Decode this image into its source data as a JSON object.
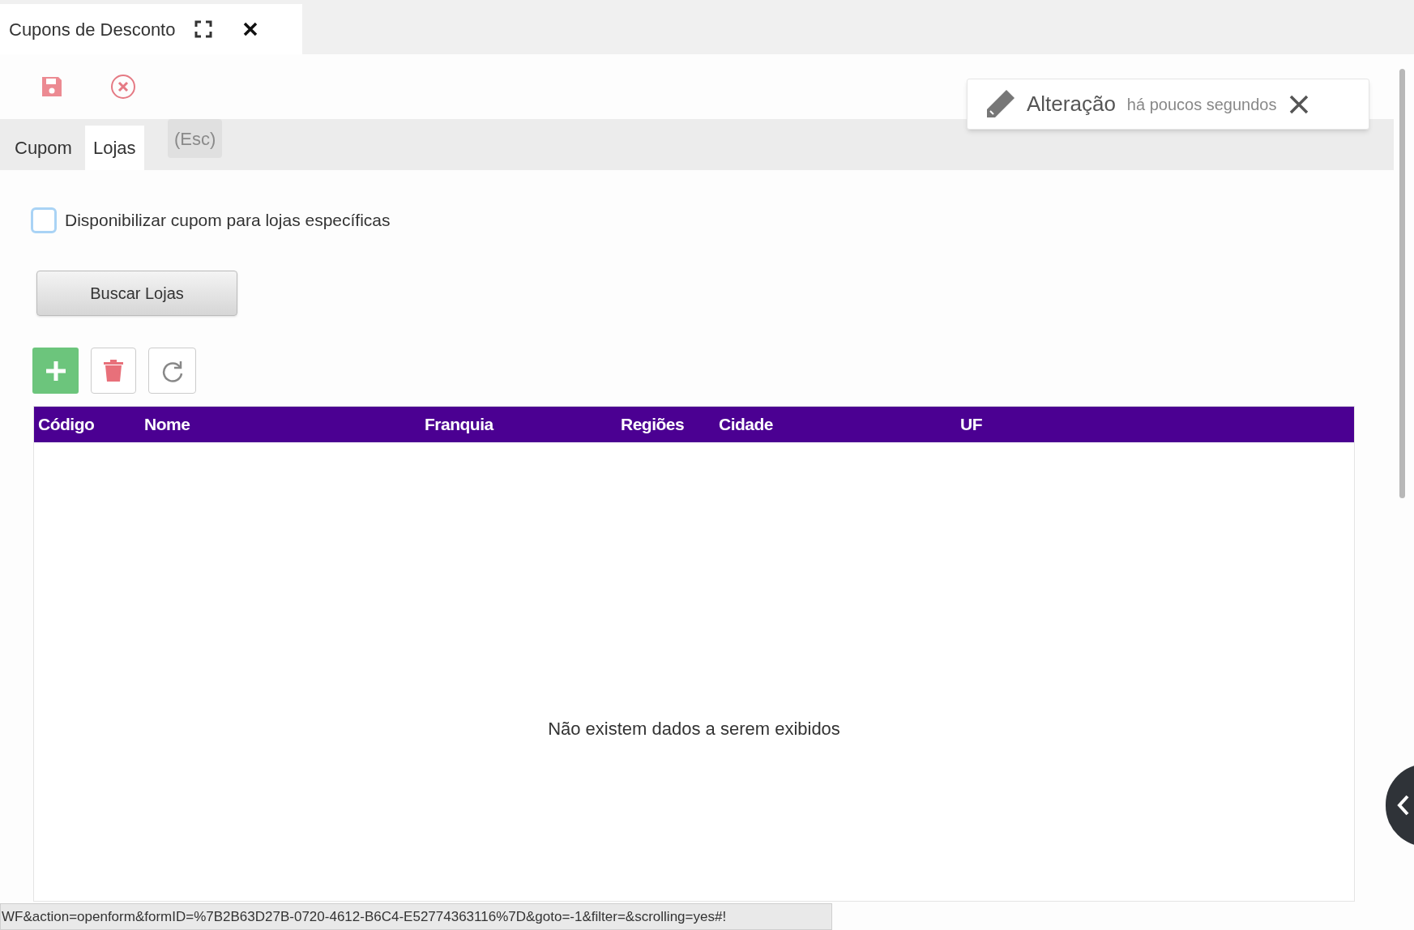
{
  "window_tab": {
    "title": "Cupons de Desconto"
  },
  "toolbar": {
    "tooltip": "(Esc)"
  },
  "notification": {
    "title": "Alteração",
    "time": "há poucos segundos"
  },
  "tabs": [
    {
      "label": "Cupom",
      "selected": false
    },
    {
      "label": "Lojas",
      "selected": true
    }
  ],
  "checkbox": {
    "label": "Disponibilizar cupom para lojas específicas",
    "checked": false
  },
  "search_button": "Buscar Lojas",
  "table": {
    "columns": [
      "Código",
      "Nome",
      "Franquia",
      "Regiões",
      "Cidade",
      "UF"
    ],
    "empty_message": "Não existem dados a serem exibidos"
  },
  "status_bar": "WF&action=openform&formID=%7B2B63D27B-0720-4612-B6C4-E52774363116%7D&goto=-1&filter=&scrolling=yes#!"
}
